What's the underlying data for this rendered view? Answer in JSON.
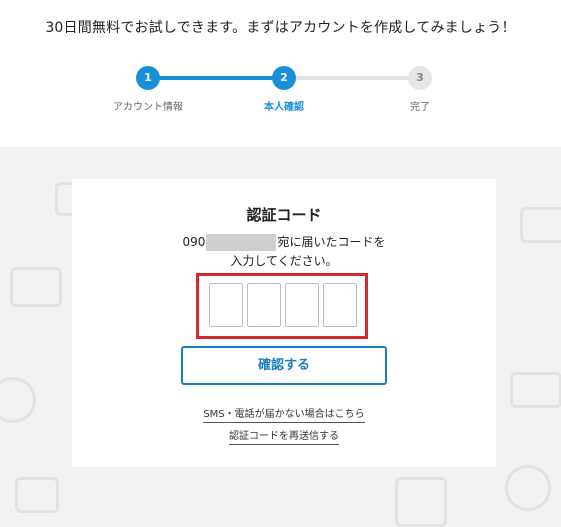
{
  "header": {
    "headline": "30日間無料でお試しできます。まずはアカウントを作成してみましょう！"
  },
  "stepper": {
    "steps": [
      {
        "number": "1",
        "label": "アカウント情報",
        "state": "completed"
      },
      {
        "number": "2",
        "label": "本人確認",
        "state": "active"
      },
      {
        "number": "3",
        "label": "完了",
        "state": "pending"
      }
    ]
  },
  "card": {
    "title": "認証コード",
    "phone_prefix": "090",
    "message_suffix": "宛に届いたコードを",
    "message_line2": "入力してください。",
    "code_digits": [
      "",
      "",
      "",
      ""
    ],
    "confirm_label": "確認する",
    "sms_help_link": "SMS・電話が届かない場合はこちら",
    "resend_link": "認証コードを再送信する"
  },
  "colors": {
    "accent": "#1a8fd9",
    "highlight_border": "#d42a2f",
    "background": "#f2f2f2"
  }
}
